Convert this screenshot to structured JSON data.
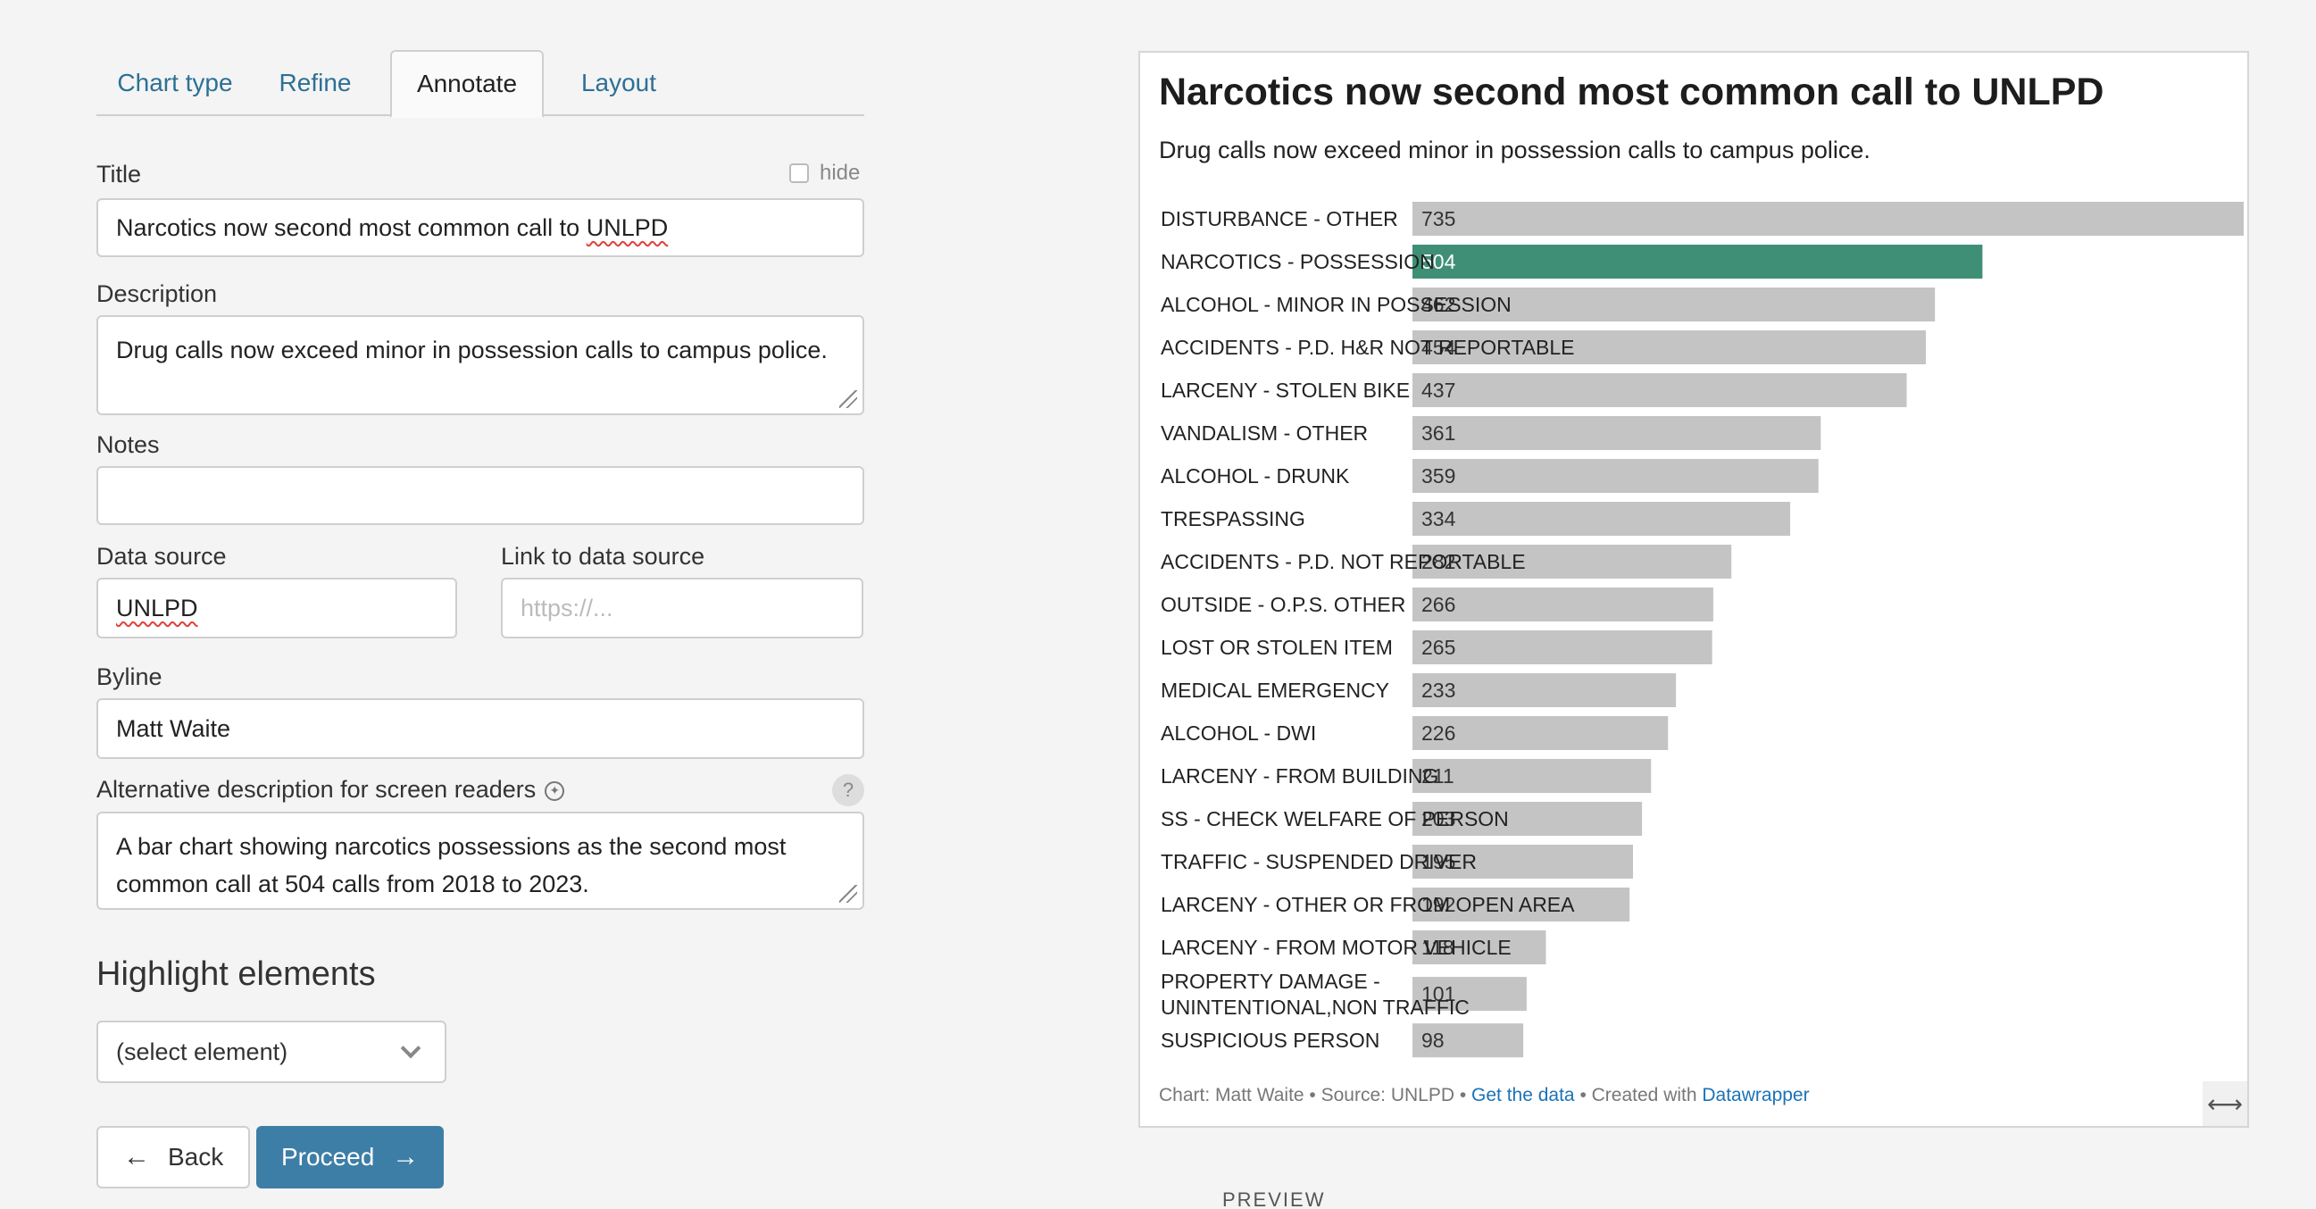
{
  "tabs": [
    {
      "label": "Chart type"
    },
    {
      "label": "Refine"
    },
    {
      "label": "Annotate"
    },
    {
      "label": "Layout"
    }
  ],
  "active_tab": "Annotate",
  "form": {
    "title_label": "Title",
    "hide_label": "hide",
    "title_value": "Narcotics now second most common call to UNLPD",
    "description_label": "Description",
    "description_value": "Drug calls now exceed minor in possession calls to campus police.",
    "notes_label": "Notes",
    "notes_value": "",
    "data_source_label": "Data source",
    "data_source_value": "UNLPD",
    "link_label": "Link to data source",
    "link_placeholder": "https://...",
    "byline_label": "Byline",
    "byline_value": "Matt Waite",
    "alt_label": "Alternative description for screen readers",
    "alt_value": "A bar chart showing narcotics possessions as the second most common call at 504 calls from 2018 to 2023.",
    "help_glyph": "?"
  },
  "highlight": {
    "heading": "Highlight elements",
    "select_value": "(select element)"
  },
  "buttons": {
    "back": "Back",
    "proceed": "Proceed"
  },
  "preview": {
    "footer_chart": "Chart: Matt Waite • Source: UNLPD • ",
    "footer_get_data": "Get the data",
    "footer_created": " • Created with ",
    "footer_datawrapper": "Datawrapper",
    "preview_label": "PREVIEW"
  },
  "colors": {
    "bar_default": "#c4c4c4",
    "bar_highlight": "#3f8f76",
    "link": "#1a73b8",
    "proceed_button": "#3d7ea6"
  },
  "chart_data": {
    "type": "bar",
    "orientation": "horizontal",
    "title": "Narcotics now second most common call to UNLPD",
    "subtitle": "Drug calls now exceed minor in possession calls to campus police.",
    "categories": [
      "DISTURBANCE - OTHER",
      "NARCOTICS - POSSESSION",
      "ALCOHOL - MINOR IN POSSESSION",
      "ACCIDENTS - P.D. H&R NOT REPORTABLE",
      "LARCENY - STOLEN BIKE",
      "VANDALISM - OTHER",
      "ALCOHOL - DRUNK",
      "TRESPASSING",
      "ACCIDENTS - P.D. NOT REPORTABLE",
      "OUTSIDE - O.P.S. OTHER",
      "LOST OR STOLEN ITEM",
      "MEDICAL EMERGENCY",
      "ALCOHOL - DWI",
      "LARCENY - FROM BUILDING",
      "SS - CHECK WELFARE OF PERSON",
      "TRAFFIC - SUSPENDED DRIVER",
      "LARCENY - OTHER OR FROM OPEN AREA",
      "LARCENY - FROM MOTOR VEHICLE",
      "PROPERTY DAMAGE - UNINTENTIONAL,NON TRAFFIC",
      "SUSPICIOUS PERSON"
    ],
    "values": [
      735,
      504,
      462,
      454,
      437,
      361,
      359,
      334,
      282,
      266,
      265,
      233,
      226,
      211,
      203,
      195,
      192,
      118,
      101,
      98
    ],
    "highlighted": [
      "NARCOTICS - POSSESSION"
    ],
    "xlim": [
      0,
      735
    ],
    "grid": false,
    "legend": "none"
  }
}
